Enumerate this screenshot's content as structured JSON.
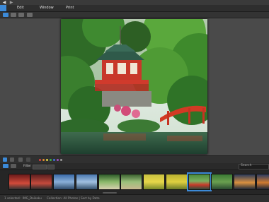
{
  "menu": {
    "edit": "Edit",
    "window": "Window",
    "print": "Print"
  },
  "search": {
    "placeholder": "Search"
  },
  "filter": {
    "label": "Filter"
  },
  "status": {
    "left": "1 selected : IMG_Daikaku",
    "right": "Collection: All Photos  |  Sort by Date"
  },
  "colors": {
    "accent": "#3c8ad8",
    "rating_dots": [
      "#e04040",
      "#e08a30",
      "#e0d040",
      "#40b040",
      "#4070e0",
      "#a050c0",
      "#999999"
    ]
  },
  "icons": {
    "back": "back-icon",
    "forward": "forward-icon",
    "grid": "grid-view-icon",
    "single": "single-view-icon",
    "compare": "compare-view-icon",
    "screen": "fullscreen-icon",
    "search": "search-icon"
  },
  "thumbnails": [
    {
      "name": "thumb-1"
    },
    {
      "name": "thumb-2"
    },
    {
      "name": "thumb-3"
    },
    {
      "name": "thumb-4"
    },
    {
      "name": "thumb-5"
    },
    {
      "name": "thumb-6"
    },
    {
      "name": "thumb-7"
    },
    {
      "name": "thumb-8"
    },
    {
      "name": "thumb-9",
      "selected": true
    },
    {
      "name": "thumb-10"
    },
    {
      "name": "thumb-11"
    },
    {
      "name": "thumb-12"
    }
  ]
}
